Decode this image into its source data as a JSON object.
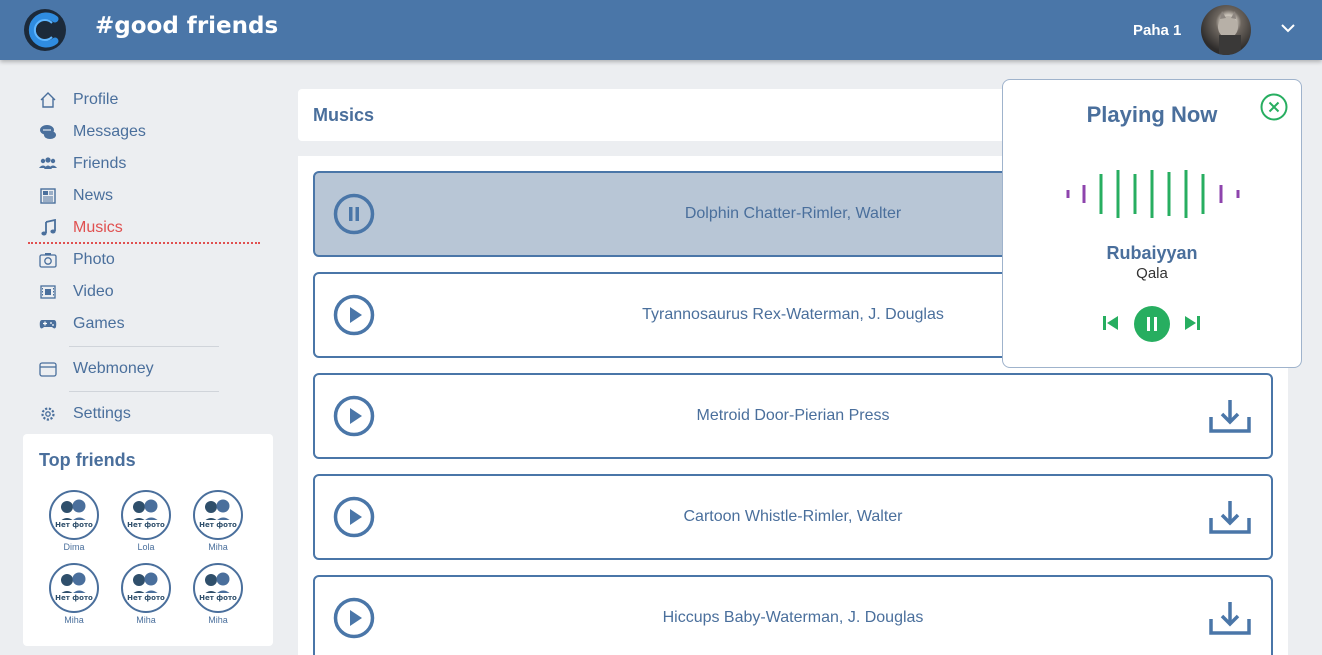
{
  "header": {
    "site_title": "#good friends",
    "username": "Paha 1",
    "logo_icon": "site-logo-c",
    "chevron_icon": "chevron-down-icon"
  },
  "sidebar": {
    "items": [
      {
        "label": "Profile",
        "icon": "home-icon"
      },
      {
        "label": "Messages",
        "icon": "chat-icon"
      },
      {
        "label": "Friends",
        "icon": "people-icon"
      },
      {
        "label": "News",
        "icon": "newspaper-icon"
      },
      {
        "label": "Musics",
        "icon": "music-note-icon",
        "active": true
      },
      {
        "label": "Photo",
        "icon": "camera-icon"
      },
      {
        "label": "Video",
        "icon": "film-icon"
      },
      {
        "label": "Games",
        "icon": "gamepad-icon"
      },
      {
        "label": "Webmoney",
        "icon": "wallet-icon"
      },
      {
        "label": "Settings",
        "icon": "gear-icon"
      }
    ]
  },
  "top_friends": {
    "title": "Top friends",
    "friends": [
      {
        "name": "Dima"
      },
      {
        "name": "Lola"
      },
      {
        "name": "Miha"
      },
      {
        "name": "Miha"
      },
      {
        "name": "Miha"
      },
      {
        "name": "Miha"
      }
    ],
    "placeholder_text": "Нет фото"
  },
  "main": {
    "title": "Musics",
    "tracks": [
      {
        "title": "Dolphin Chatter-Rimler, Walter",
        "playing": true
      },
      {
        "title": "Tyrannosaurus Rex-Waterman, J. Douglas",
        "playing": false
      },
      {
        "title": "Metroid Door-Pierian Press",
        "playing": false
      },
      {
        "title": "Cartoon Whistle-Rimler, Walter",
        "playing": false
      },
      {
        "title": "Hiccups Baby-Waterman, J. Douglas",
        "playing": false
      }
    ]
  },
  "player": {
    "heading": "Playing Now",
    "song": "Rubaiyyan",
    "artist": "Qala"
  },
  "colors": {
    "brand": "#4a76a8",
    "text": "#4a6f9c",
    "active_nav": "#e05050",
    "accent_green": "#27ae60",
    "wave_purple": "#8e44ad"
  }
}
